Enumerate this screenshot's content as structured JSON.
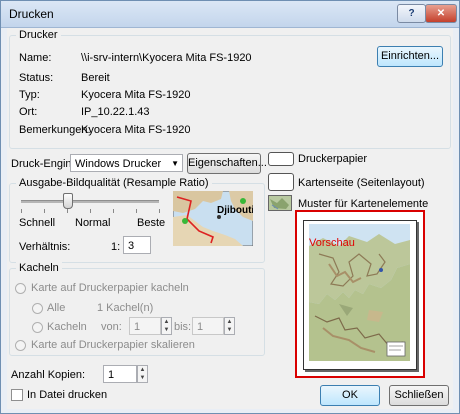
{
  "window": {
    "title": "Drucken",
    "help_label": "?",
    "close_label": "✕"
  },
  "printer": {
    "group_title": "Drucker",
    "name_label": "Name:",
    "name_value": "\\\\i-srv-intern\\Kyocera Mita FS-1920",
    "setup_button": "Einrichten...",
    "status_label": "Status:",
    "status_value": "Bereit",
    "type_label": "Typ:",
    "type_value": "Kyocera Mita FS-1920",
    "location_label": "Ort:",
    "location_value": "IP_10.22.1.43",
    "comments_label": "Bemerkungen:",
    "comments_value": "Kyocera Mita FS-1920"
  },
  "engine": {
    "label": "Druck-Engine:",
    "value": "Windows Drucker",
    "properties_button": "Eigenschaften..."
  },
  "quality": {
    "group_title": "Ausgabe-Bildqualität (Resample Ratio)",
    "fast": "Schnell",
    "normal": "Normal",
    "best": "Beste",
    "level": 0.33,
    "ratio_label": "Verhältnis:",
    "ratio_prefix": "1:",
    "ratio_value": "3",
    "thumb_label": "Djibouti"
  },
  "legend": {
    "printer_paper": "Druckerpapier",
    "page_layout": "Kartenseite (Seitenlayout)",
    "pattern": "Muster für Kartenelemente"
  },
  "preview": {
    "label": "Vorschau"
  },
  "tiling": {
    "group_title": "Kacheln",
    "tile_option": "Karte auf Druckerpapier kacheln",
    "all_label": "Alle",
    "tile_count": "1 Kachel(n)",
    "tiles_label": "Kacheln",
    "from_label": "von:",
    "from_value": "1",
    "to_label": "bis:",
    "to_value": "1",
    "scale_option": "Karte auf Druckerpapier skalieren"
  },
  "copies": {
    "label": "Anzahl Kopien:",
    "value": "1"
  },
  "print_to_file": "In Datei drucken",
  "buttons": {
    "ok": "OK",
    "close": "Schließen"
  },
  "colors": {
    "preview_frame": "#d90000",
    "title_bar": "#c3d5ec",
    "close_red": "#c4402c"
  }
}
